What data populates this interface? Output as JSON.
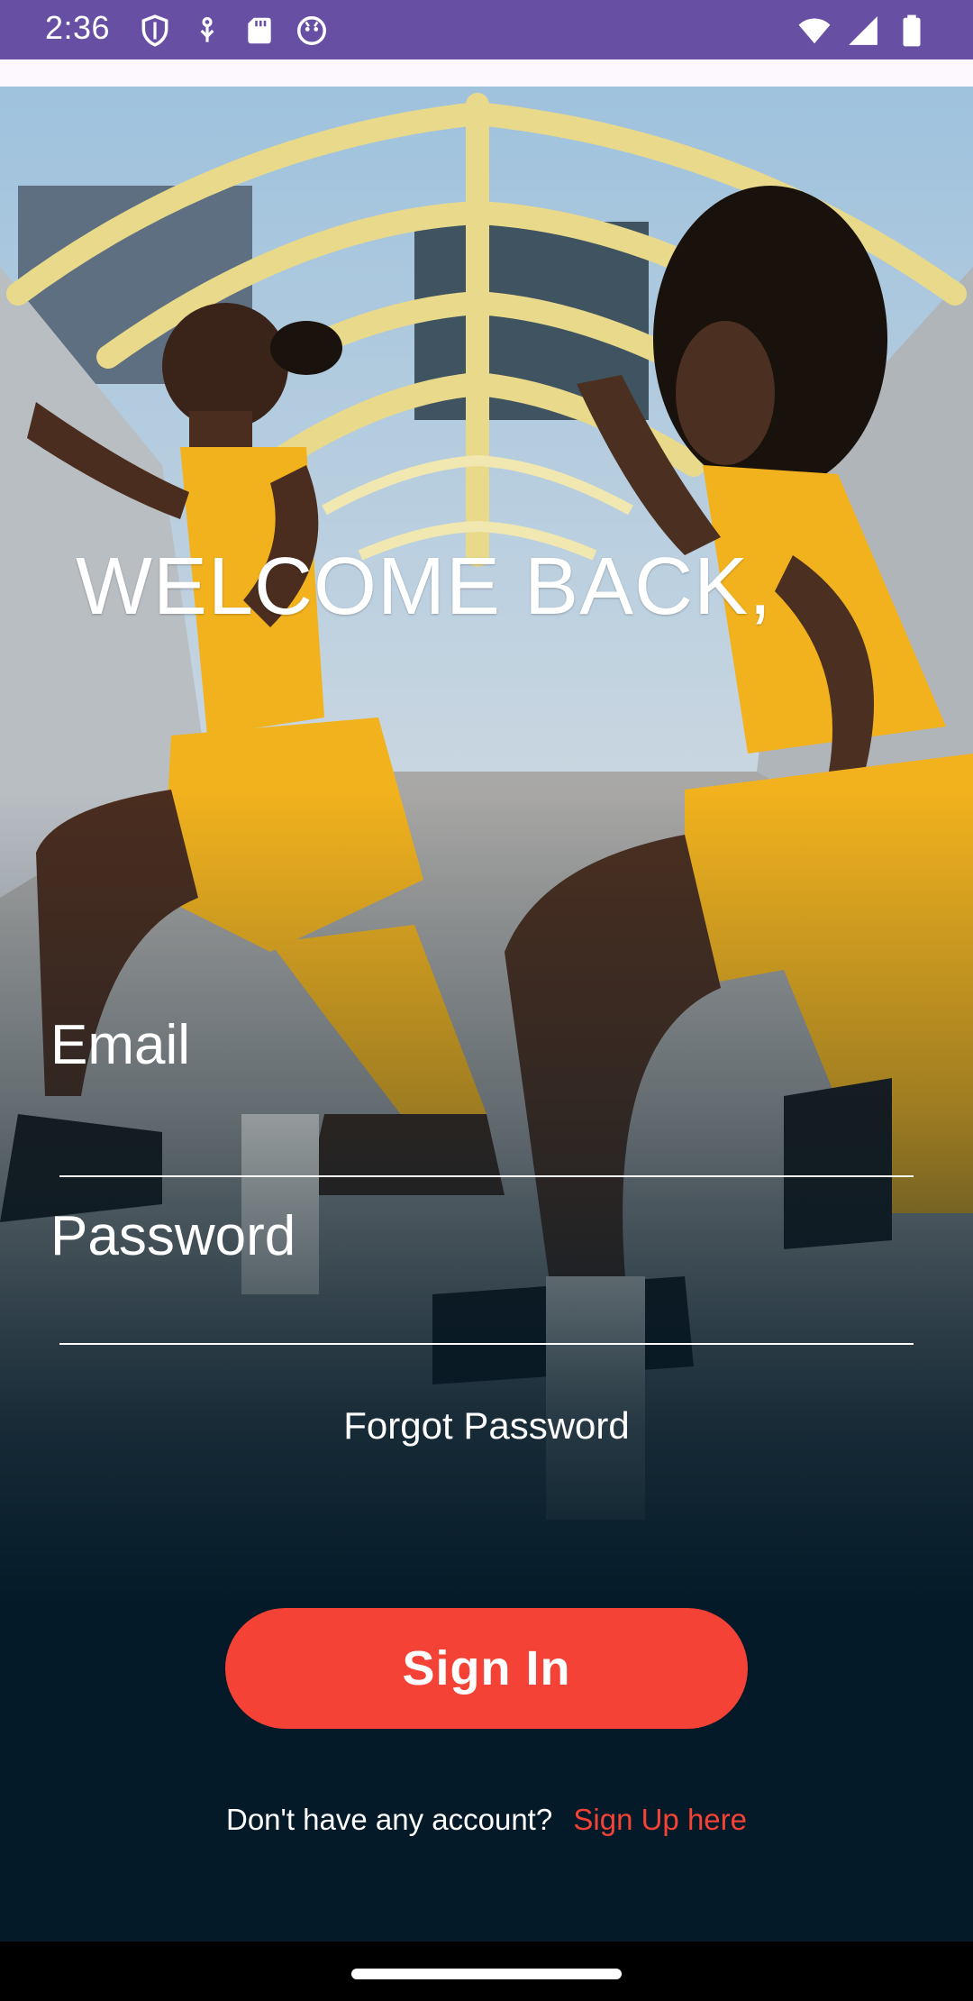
{
  "status_bar": {
    "time": "2:36",
    "left_icons": [
      "shield-icon",
      "usb-icon",
      "sd-card-icon",
      "face-icon"
    ],
    "right_icons": [
      "wifi-icon",
      "signal-icon",
      "battery-icon"
    ],
    "background": "#6750A4"
  },
  "login": {
    "title": "WELCOME BACK,",
    "email_label": "Email",
    "password_label": "Password",
    "forgot_password": "Forgot Password",
    "sign_in_label": "Sign In",
    "signup_prompt": "Don't have any account?",
    "signup_link": "Sign Up here"
  },
  "colors": {
    "accent": "#F44336",
    "overlay_dark": "#041A28",
    "outfit_yellow": "#F2B21E"
  }
}
